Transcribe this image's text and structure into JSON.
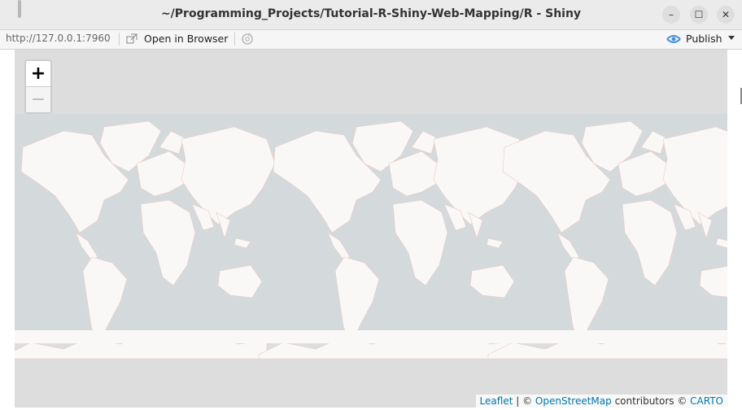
{
  "window": {
    "title": "~/Programming_Projects/Tutorial-R-Shiny-Web-Mapping/R - Shiny",
    "minimize_label": "–",
    "maximize_label": "☐",
    "close_label": "✕"
  },
  "toolbar": {
    "url": "http://127.0.0.1:7960",
    "open_in_browser_label": "Open in Browser",
    "publish_label": "Publish"
  },
  "map": {
    "zoom_in_label": "+",
    "zoom_out_label": "−",
    "attribution": {
      "leaflet": "Leaflet",
      "sep1": " | © ",
      "osm": "OpenStreetMap",
      "contrib": " contributors © ",
      "carto": "CARTO"
    },
    "colors": {
      "ocean": "#d4dadc",
      "land": "#faf8f6",
      "border": "#e8c8c8",
      "background": "#dddddd"
    }
  }
}
